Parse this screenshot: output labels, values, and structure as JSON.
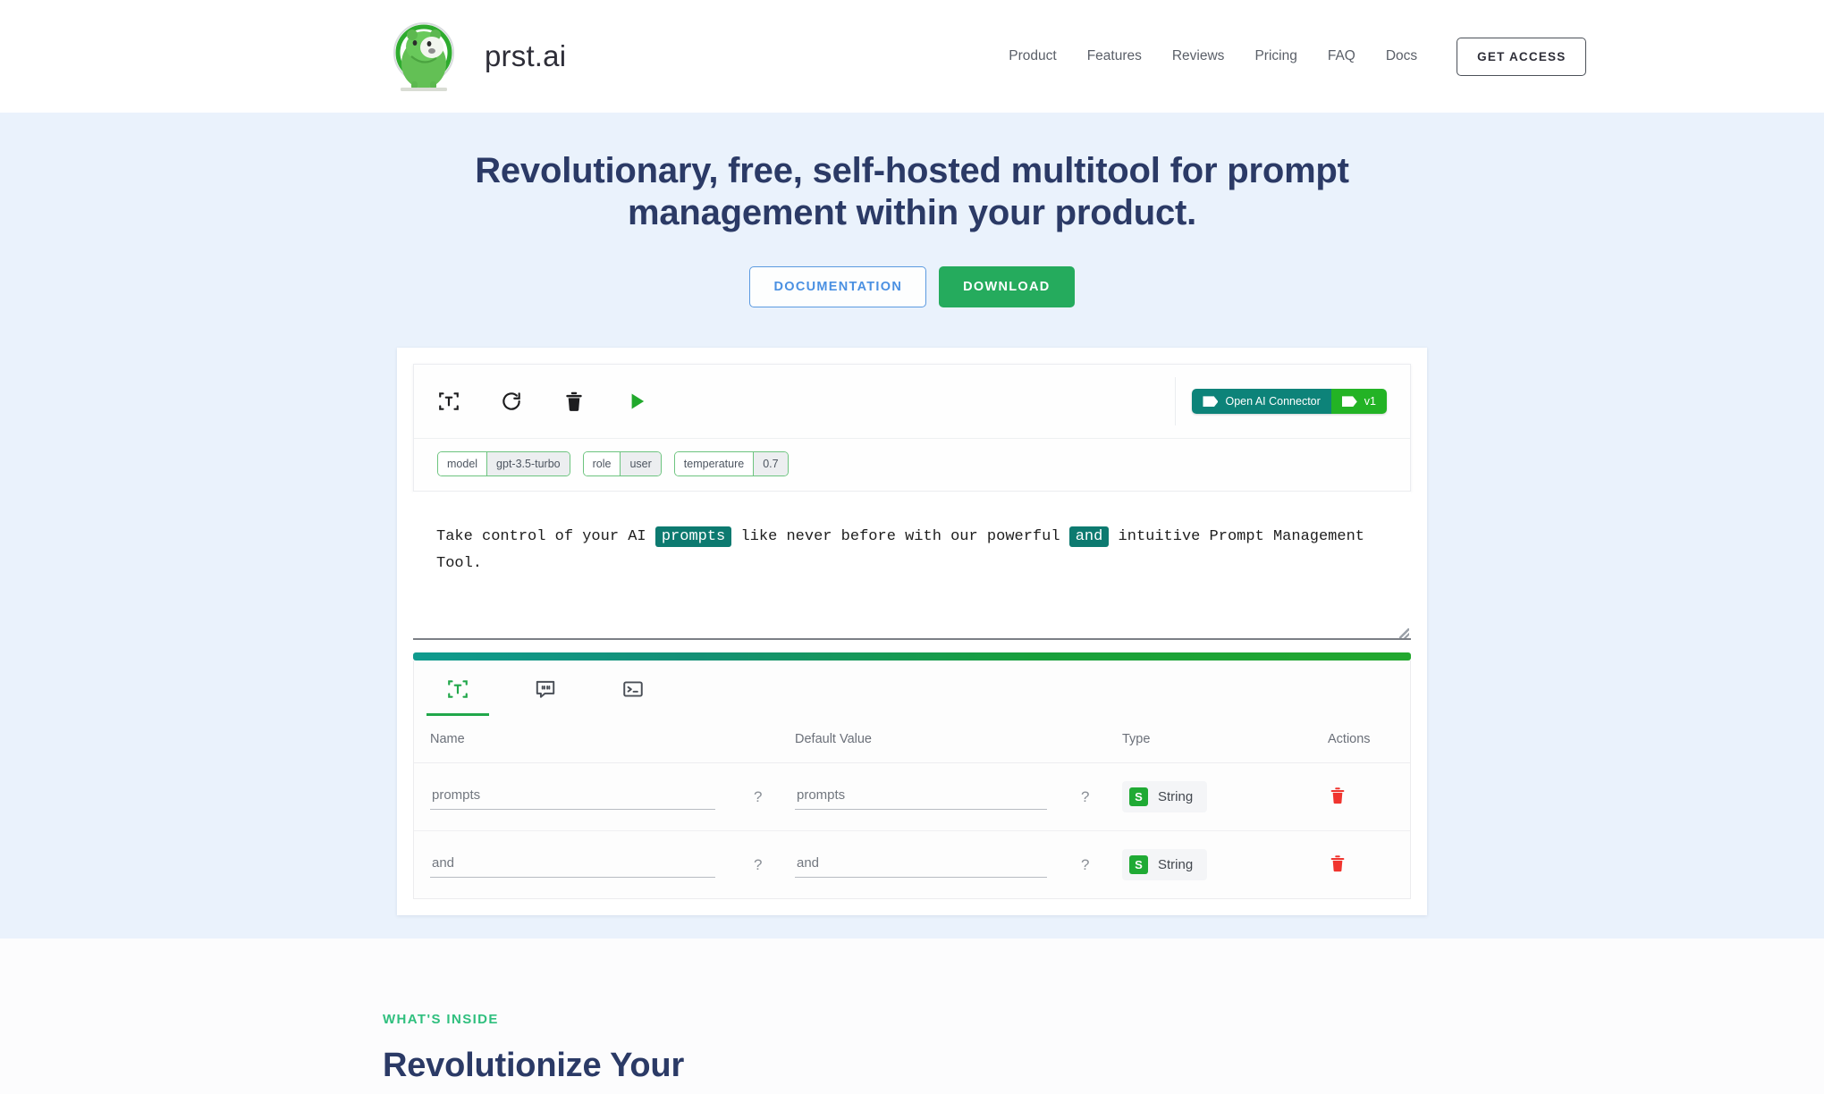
{
  "header": {
    "brand_name": "prst.ai",
    "logo_icon": "capybara-mascot-logo",
    "nav": [
      {
        "label": "Product"
      },
      {
        "label": "Features"
      },
      {
        "label": "Reviews"
      },
      {
        "label": "Pricing"
      },
      {
        "label": "FAQ"
      },
      {
        "label": "Docs"
      }
    ],
    "get_access_label": "GET ACCESS"
  },
  "hero": {
    "headline": "Revolutionary, free, self-hosted multitool for prompt management within your product.",
    "documentation_label": "DOCUMENTATION",
    "download_label": "DOWNLOAD",
    "doc_accent": "#4a90e2",
    "download_accent": "#25ab5d"
  },
  "app": {
    "toolbar": {
      "icons": [
        {
          "name": "scan-text-icon"
        },
        {
          "name": "refresh-icon"
        },
        {
          "name": "trash-icon"
        },
        {
          "name": "run-play-icon"
        }
      ],
      "connector_badge": "Open AI Connector",
      "version_badge": "v1",
      "connector_color": "#0d8379",
      "version_color": "#23b325"
    },
    "chips": [
      {
        "key": "model",
        "value": "gpt-3.5-turbo"
      },
      {
        "key": "role",
        "value": "user"
      },
      {
        "key": "temperature",
        "value": "0.7"
      }
    ],
    "prompt": {
      "part1": "Take control of your AI ",
      "var1": "prompts",
      "part2": " like never before with our powerful ",
      "var2": "and",
      "part3": " intuitive Prompt Management Tool.",
      "variable_color": "#0d7a70"
    },
    "tabs": [
      {
        "name": "variables-tab",
        "icon": "scan-text-icon",
        "active": true
      },
      {
        "name": "messages-tab",
        "icon": "quote-bubble-icon",
        "active": false
      },
      {
        "name": "console-tab",
        "icon": "terminal-icon",
        "active": false
      }
    ],
    "variables_table": {
      "columns": [
        "Name",
        "Default Value",
        "Type",
        "Actions"
      ],
      "rows": [
        {
          "name": "prompts",
          "default_value": "prompts",
          "type": "String",
          "type_badge": "S"
        },
        {
          "name": "and",
          "default_value": "and",
          "type": "String",
          "type_badge": "S"
        }
      ],
      "help_marker": "?",
      "type_badge_color": "#1faa34",
      "delete_color": "#f0352f"
    }
  },
  "inside": {
    "eyebrow": "WHAT'S INSIDE",
    "heading": "Revolutionize Your",
    "eyebrow_color": "#2fbf7e"
  }
}
